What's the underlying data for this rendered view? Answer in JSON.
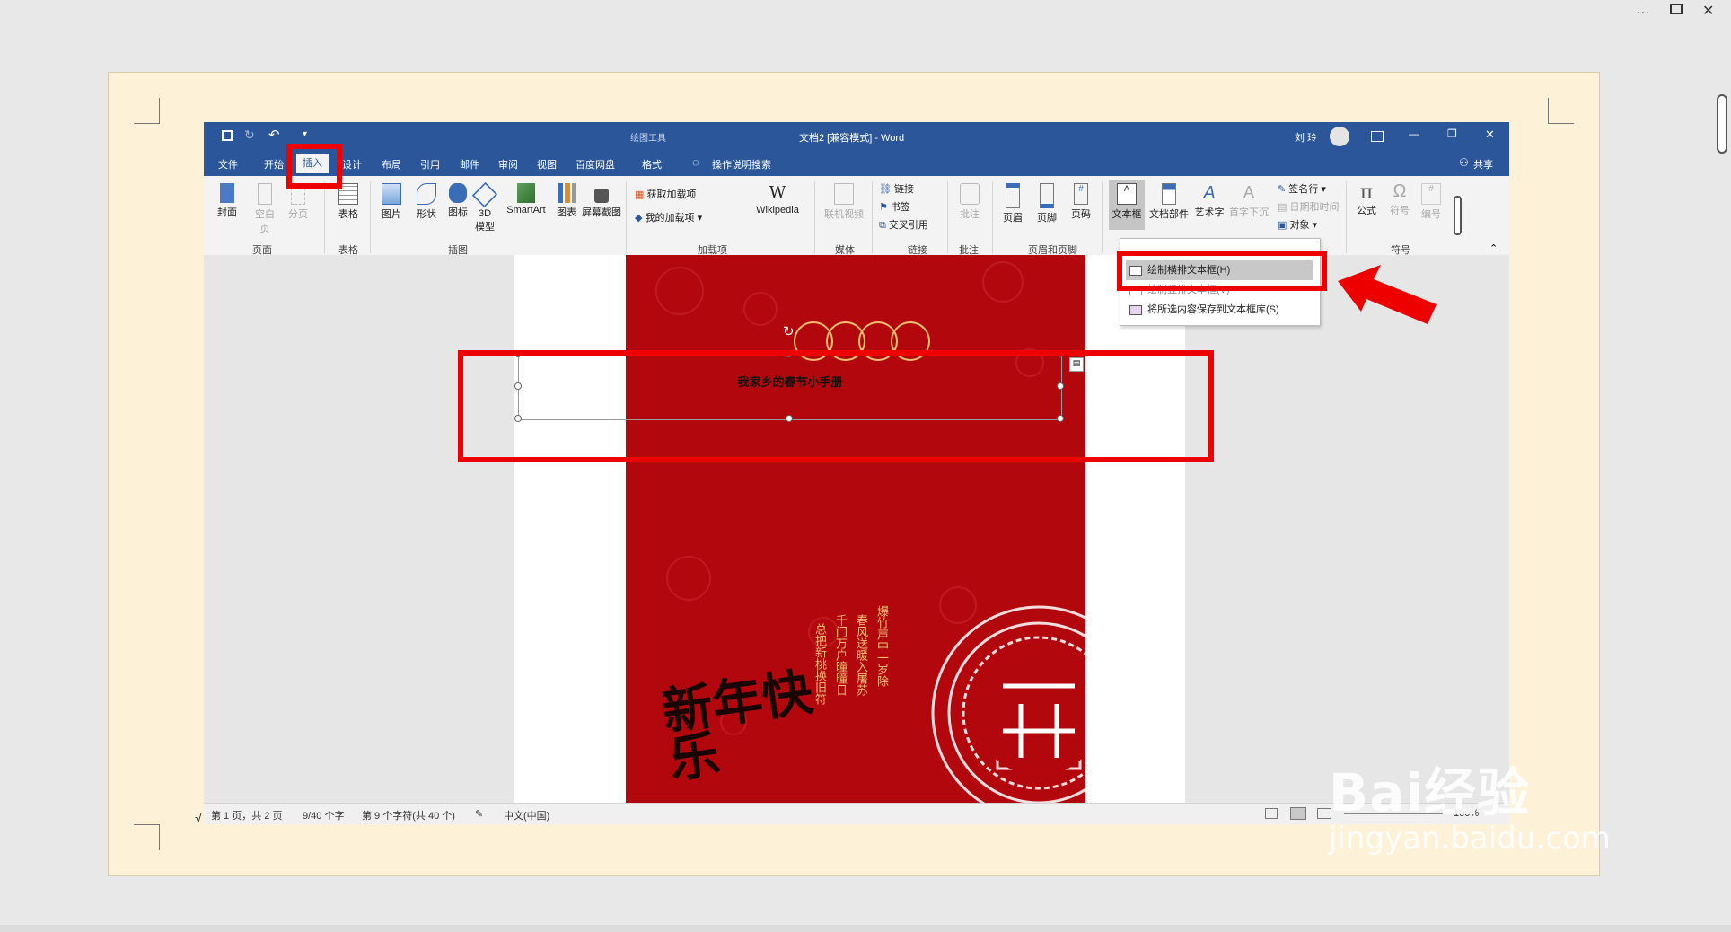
{
  "host": {
    "more_icon": "…",
    "restore_icon": "restore",
    "close_icon": "✕"
  },
  "word": {
    "title": "文档2 [兼容模式] - Word",
    "contextual_label": "绘图工具",
    "user_name": "刘 玲",
    "quick_access": {
      "save": "save-icon",
      "undo": "↶",
      "customize": "▾"
    },
    "window_controls": {
      "minimize": "—",
      "restore": "❐",
      "close": "✕"
    },
    "tabs": [
      "文件",
      "开始",
      "插入",
      "设计",
      "布局",
      "引用",
      "邮件",
      "审阅",
      "视图",
      "百度网盘",
      "格式"
    ],
    "active_tab": "插入",
    "tell_me": "操作说明搜索",
    "share": "共享",
    "ribbon": {
      "pages": {
        "group": "页面",
        "items": [
          "封面",
          "空白页",
          "分页"
        ]
      },
      "tables": {
        "group": "表格",
        "items": [
          "表格"
        ]
      },
      "illustrations": {
        "group": "插图",
        "items": [
          "图片",
          "形状",
          "图标",
          "3D 模型",
          "SmartArt",
          "图表",
          "屏幕截图"
        ]
      },
      "addins": {
        "group": "加载项",
        "items": [
          "获取加载项",
          "我的加载项",
          "Wikipedia"
        ]
      },
      "media": {
        "group": "媒体",
        "items": [
          "联机视频"
        ]
      },
      "links": {
        "group": "链接",
        "items": [
          "链接",
          "书签",
          "交叉引用"
        ]
      },
      "comments": {
        "group": "批注",
        "items": [
          "批注"
        ]
      },
      "header_footer": {
        "group": "页眉和页脚",
        "items": [
          "页眉",
          "页脚",
          "页码"
        ]
      },
      "text": {
        "items": [
          "文本框",
          "文档部件",
          "艺术字",
          "首字下沉",
          "签名行",
          "日期和时间",
          "对象"
        ]
      },
      "symbols": {
        "group": "符号",
        "items": [
          "公式",
          "符号",
          "编号"
        ]
      }
    },
    "dropdown": {
      "items": [
        "绘制横排文本框(H)",
        "绘制竖排文本框(V)",
        "将所选内容保存到文本框库(S)"
      ]
    },
    "document": {
      "textbox_text": "我家乡的春节小手册",
      "cover_calligraphy": "新年快乐",
      "cover_vertical_text": [
        "爆竹声中一岁除",
        "春风送暖入屠苏",
        "千门万户曈曈日",
        "总把新桃换旧符"
      ]
    },
    "status": {
      "page": "第 1 页，共 2 页",
      "words": "9/40 个字",
      "chars": "第 9 个字符(共 40 个)",
      "language": "中文(中国)",
      "zoom": "100%"
    }
  },
  "outside_mark": "√",
  "watermark": {
    "brand": "Bai经验",
    "url": "jingyan.baidu.com"
  },
  "colors": {
    "word_blue": "#2b579a",
    "highlight_red": "#ee0000",
    "cover_red": "#b3070e"
  }
}
